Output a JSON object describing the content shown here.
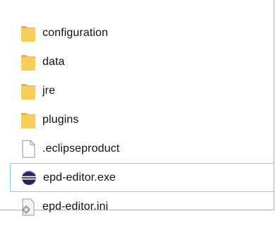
{
  "explorer": {
    "items": [
      {
        "label": "configuration",
        "icon": "folder-icon",
        "selected": false
      },
      {
        "label": "data",
        "icon": "folder-icon",
        "selected": false
      },
      {
        "label": "jre",
        "icon": "folder-icon",
        "selected": false
      },
      {
        "label": "plugins",
        "icon": "folder-icon",
        "selected": false
      },
      {
        "label": ".eclipseproduct",
        "icon": "blank-file-icon",
        "selected": false
      },
      {
        "label": "epd-editor.exe",
        "icon": "eclipse-app-icon",
        "selected": true
      },
      {
        "label": "epd-editor.ini",
        "icon": "settings-file-icon",
        "selected": false
      }
    ]
  },
  "colors": {
    "folder": "#f7cd5c",
    "folder_dark": "#e9b33c",
    "selection_border": "#99c9ef",
    "eclipse_blue": "#2c2255"
  }
}
